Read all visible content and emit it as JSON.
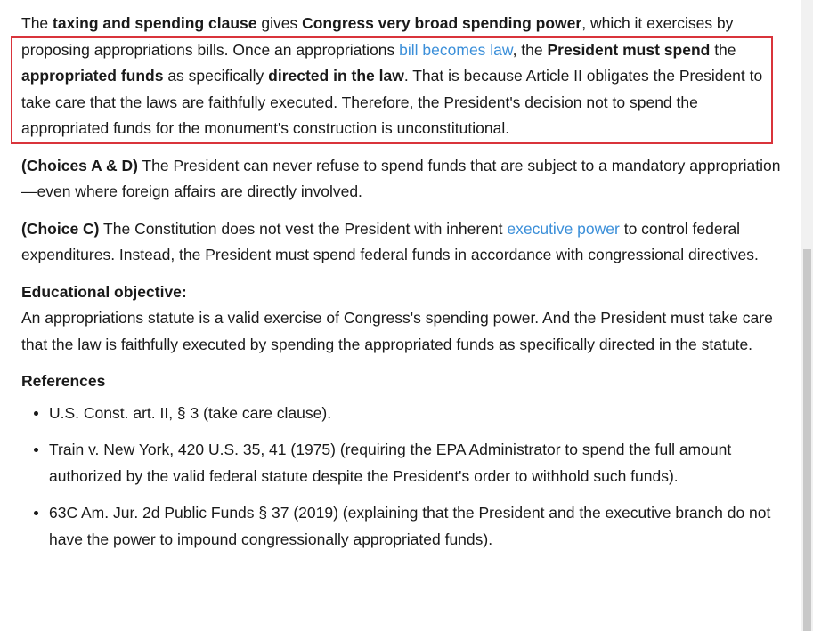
{
  "main": {
    "p1": {
      "t1": "The ",
      "b1": "taxing and spending clause",
      "t2": " gives ",
      "b2": "Congress very broad spending power",
      "t3": ", which it exercises by proposing appropriations bills.  Once an appropriations ",
      "link": "bill becomes law",
      "t4": ", the ",
      "b3": "President must spend",
      "t5": " the ",
      "b4": "appropriated funds",
      "t6": " as specifically ",
      "b5": "directed in the law",
      "t7": ".  That is because Article II obligates the President to take care that the laws are faithfully executed.  Therefore, the President's decision not to spend the appropriated funds for the monument's construction is unconstitutional."
    },
    "p2": {
      "label": "(Choices A & D)",
      "text": "  The President can never refuse to spend funds that are subject to a mandatory appropriation—even where foreign affairs are directly involved."
    },
    "p3": {
      "label": "(Choice C)",
      "t1": "  The Constitution does not vest the President with inherent ",
      "link": "executive power",
      "t2": " to control federal expenditures.  Instead, the President must spend federal funds in accordance with congressional directives."
    },
    "objective": {
      "heading": "Educational objective:",
      "text": "An appropriations statute is a valid exercise of Congress's spending power.  And the President must take care that the law is faithfully executed by spending the appropriated funds as specifically directed in the statute."
    },
    "references": {
      "heading": "References",
      "items": [
        "U.S. Const. art. II, § 3 (take care clause).",
        "Train v. New York, 420 U.S. 35, 41 (1975) (requiring the EPA Administrator to spend the full amount authorized by the valid federal statute despite the President's order to withhold such funds).",
        "63C Am. Jur. 2d Public Funds § 37 (2019) (explaining that the President and the executive branch do not have the power to impound congressionally appropriated funds)."
      ]
    }
  },
  "colors": {
    "link": "#3b8fd9",
    "highlight_border": "#d9343b",
    "text": "#1a1a1a"
  }
}
